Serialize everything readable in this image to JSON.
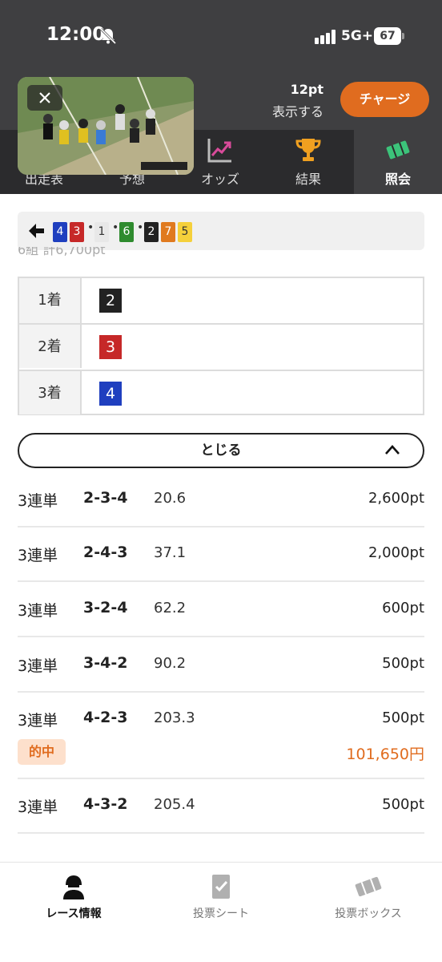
{
  "status_bar": {
    "time": "12:00",
    "network": "5G+",
    "battery": "67"
  },
  "header": {
    "points": "12pt",
    "points_toggle": "表示する",
    "charge_button": "チャージ"
  },
  "nav_tabs": [
    {
      "label": "出走表",
      "icon": "list-icon"
    },
    {
      "label": "予想",
      "icon": "prediction-icon"
    },
    {
      "label": "オッズ",
      "icon": "chart-up-icon"
    },
    {
      "label": "結果",
      "icon": "trophy-icon"
    },
    {
      "label": "照会",
      "icon": "ticket-icon",
      "active": true
    }
  ],
  "combo_bar": {
    "segments": [
      {
        "text": "4",
        "bg": "#1f3fbf",
        "fg": "#ffffff"
      },
      {
        "text": "3",
        "bg": "#c62828",
        "fg": "#ffffff"
      },
      {
        "text": "•",
        "dot": true
      },
      {
        "text": "1",
        "bg": "#e8e8e8",
        "fg": "#333333"
      },
      {
        "text": "•",
        "dot": true
      },
      {
        "text": "6",
        "bg": "#2e8b2e",
        "fg": "#ffffff"
      },
      {
        "text": "•",
        "dot": true
      },
      {
        "text": "2",
        "bg": "#222222",
        "fg": "#ffffff"
      },
      {
        "text": "7",
        "bg": "#e07a1f",
        "fg": "#ffffff"
      },
      {
        "text": "5",
        "bg": "#f5d03b",
        "fg": "#333333"
      }
    ],
    "faded_total": "6組 計6,700pt"
  },
  "results": [
    {
      "place": "1着",
      "number": "2",
      "color": "#222222"
    },
    {
      "place": "2着",
      "number": "3",
      "color": "#c62828"
    },
    {
      "place": "3着",
      "number": "4",
      "color": "#1f3fbf"
    }
  ],
  "close_button": {
    "label": "とじる"
  },
  "bets": [
    {
      "type": "3連単",
      "combo": "2-3-4",
      "odds": "20.6",
      "amount": "2,600pt"
    },
    {
      "type": "3連単",
      "combo": "2-4-3",
      "odds": "37.1",
      "amount": "2,000pt"
    },
    {
      "type": "3連単",
      "combo": "3-2-4",
      "odds": "62.2",
      "amount": "600pt"
    },
    {
      "type": "3連単",
      "combo": "3-4-2",
      "odds": "90.2",
      "amount": "500pt"
    },
    {
      "type": "3連単",
      "combo": "4-2-3",
      "odds": "203.3",
      "amount": "500pt",
      "hit": "的中",
      "payout": "101,650円"
    },
    {
      "type": "3連単",
      "combo": "4-3-2",
      "odds": "205.4",
      "amount": "500pt"
    }
  ],
  "bottom_bar": [
    {
      "label": "レース情報",
      "icon": "racer-icon",
      "active": true
    },
    {
      "label": "投票シート",
      "icon": "vote-sheet-icon"
    },
    {
      "label": "投票ボックス",
      "icon": "ticket-box-icon"
    }
  ],
  "colors": {
    "accent": "#e06c1f",
    "header_bg": "#3f3f41",
    "nav_bg": "#2b2b2d"
  }
}
